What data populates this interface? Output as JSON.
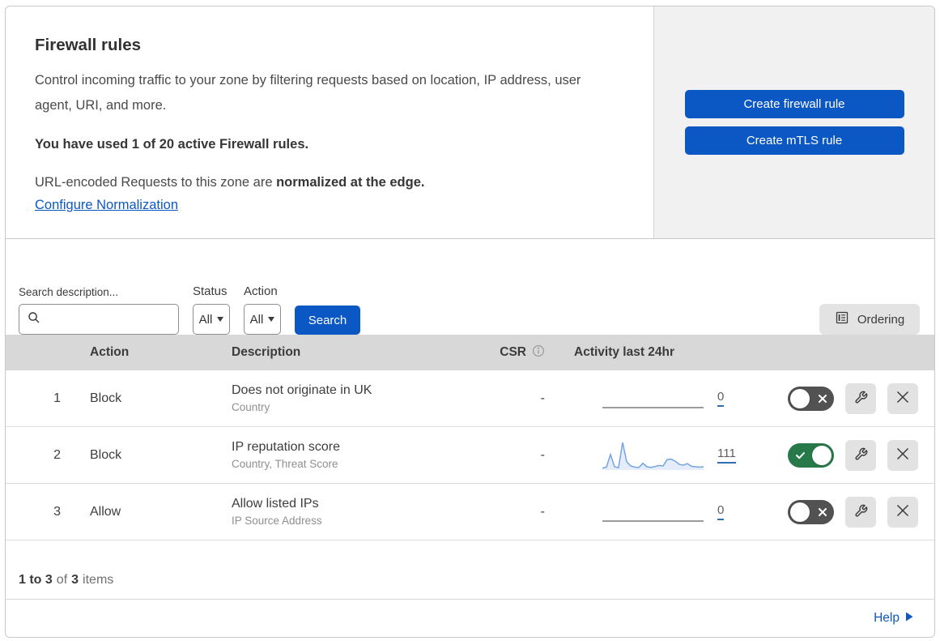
{
  "header": {
    "title": "Firewall rules",
    "description": "Control incoming traffic to your zone by filtering requests based on location, IP address, user agent, URI, and more.",
    "usage": "You have used 1 of 20 active Firewall rules.",
    "normalization_prefix": "URL-encoded Requests to this zone are ",
    "normalization_bold": "normalized at the edge.",
    "normalization_link": "Configure Normalization",
    "create_firewall_button": "Create firewall rule",
    "create_mtls_button": "Create mTLS rule"
  },
  "filters": {
    "search_label": "Search description...",
    "status_label": "Status",
    "status_value": "All",
    "action_label": "Action",
    "action_value": "All",
    "search_button": "Search",
    "ordering_button": "Ordering"
  },
  "table": {
    "columns": {
      "action": "Action",
      "description": "Description",
      "csr": "CSR",
      "activity": "Activity last 24hr"
    },
    "rows": [
      {
        "priority": "1",
        "action": "Block",
        "description": "Does not originate in UK",
        "fields": "Country",
        "csr": "-",
        "activity_count": "0",
        "enabled": false,
        "sparkline": []
      },
      {
        "priority": "2",
        "action": "Block",
        "description": "IP reputation score",
        "fields": "Country, Threat Score",
        "csr": "-",
        "activity_count": "111",
        "enabled": true,
        "sparkline": [
          4,
          8,
          55,
          9,
          6,
          100,
          28,
          12,
          8,
          6,
          22,
          9,
          7,
          10,
          14,
          12,
          36,
          38,
          30,
          18,
          15,
          21,
          11,
          9,
          8,
          9
        ]
      },
      {
        "priority": "3",
        "action": "Allow",
        "description": "Allow listed IPs",
        "fields": "IP Source Address",
        "csr": "-",
        "activity_count": "0",
        "enabled": false,
        "sparkline": []
      }
    ]
  },
  "footer": {
    "range": "1 to 3",
    "of": "of",
    "total": "3",
    "items": "items"
  },
  "help": {
    "label": "Help"
  },
  "colors": {
    "accent_blue": "#0b57c4",
    "toggle_on": "#27794a",
    "toggle_off": "#525252",
    "sparkline": "#74a3e3",
    "sparkline_fill": "#e4edf9",
    "table_header_bg": "#d8d8d8"
  }
}
